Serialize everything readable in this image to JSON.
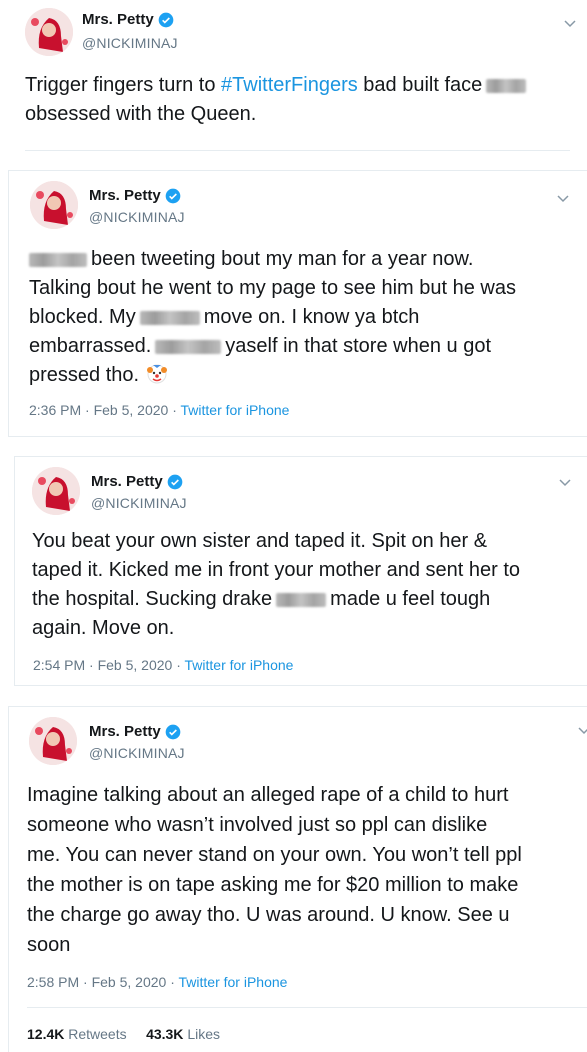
{
  "tweets": [
    {
      "name": "Mrs. Petty",
      "handle": "@NICKIMINAJ",
      "text_before": "Trigger fingers turn to ",
      "hashtag": "#TwitterFingers",
      "text_after": " bad built face",
      "line2": "obsessed with the Queen."
    },
    {
      "name": "Mrs. Petty",
      "handle": "@NICKIMINAJ",
      "l1": "been tweeting bout my man for a year now.",
      "l2": "Talking bout he went to my page to see him but he was",
      "l3a": "blocked. My",
      "l3b": "move on. I know ya btch",
      "l4a": "embarrassed.",
      "l4b": "yaself in that store when u got",
      "l5": "pressed tho.",
      "time": "2:36 PM · Feb 5, 2020 · ",
      "source": "Twitter for iPhone"
    },
    {
      "name": "Mrs. Petty",
      "handle": "@NICKIMINAJ",
      "l1": "You beat your own sister and taped it. Spit on her &",
      "l2": "taped it. Kicked me in front your mother and sent her to",
      "l3a": "the hospital. Sucking drake",
      "l3b": "made u feel tough",
      "l4": "again. Move on.",
      "time": "2:54 PM · Feb 5, 2020 · ",
      "source": "Twitter for iPhone"
    },
    {
      "name": "Mrs. Petty",
      "handle": "@NICKIMINAJ",
      "l1": "Imagine talking about an alleged rape of a child to hurt",
      "l2": "someone who wasn’t involved just so ppl can dislike",
      "l3": "me. You can never stand on your own. You won’t tell ppl",
      "l4": "the mother is on tape asking me for $20 million to make",
      "l5": "the charge go away tho. U was around. U know. See u",
      "l6": "soon",
      "time": "2:58 PM · Feb 5, 2020 · ",
      "source": "Twitter for iPhone"
    }
  ],
  "stats": {
    "retweets_count": "12.4K",
    "retweets_label": "Retweets",
    "likes_count": "43.3K",
    "likes_label": "Likes"
  },
  "colors": {
    "link": "#1b95e0",
    "muted": "#657786",
    "verified": "#1da1f2"
  }
}
